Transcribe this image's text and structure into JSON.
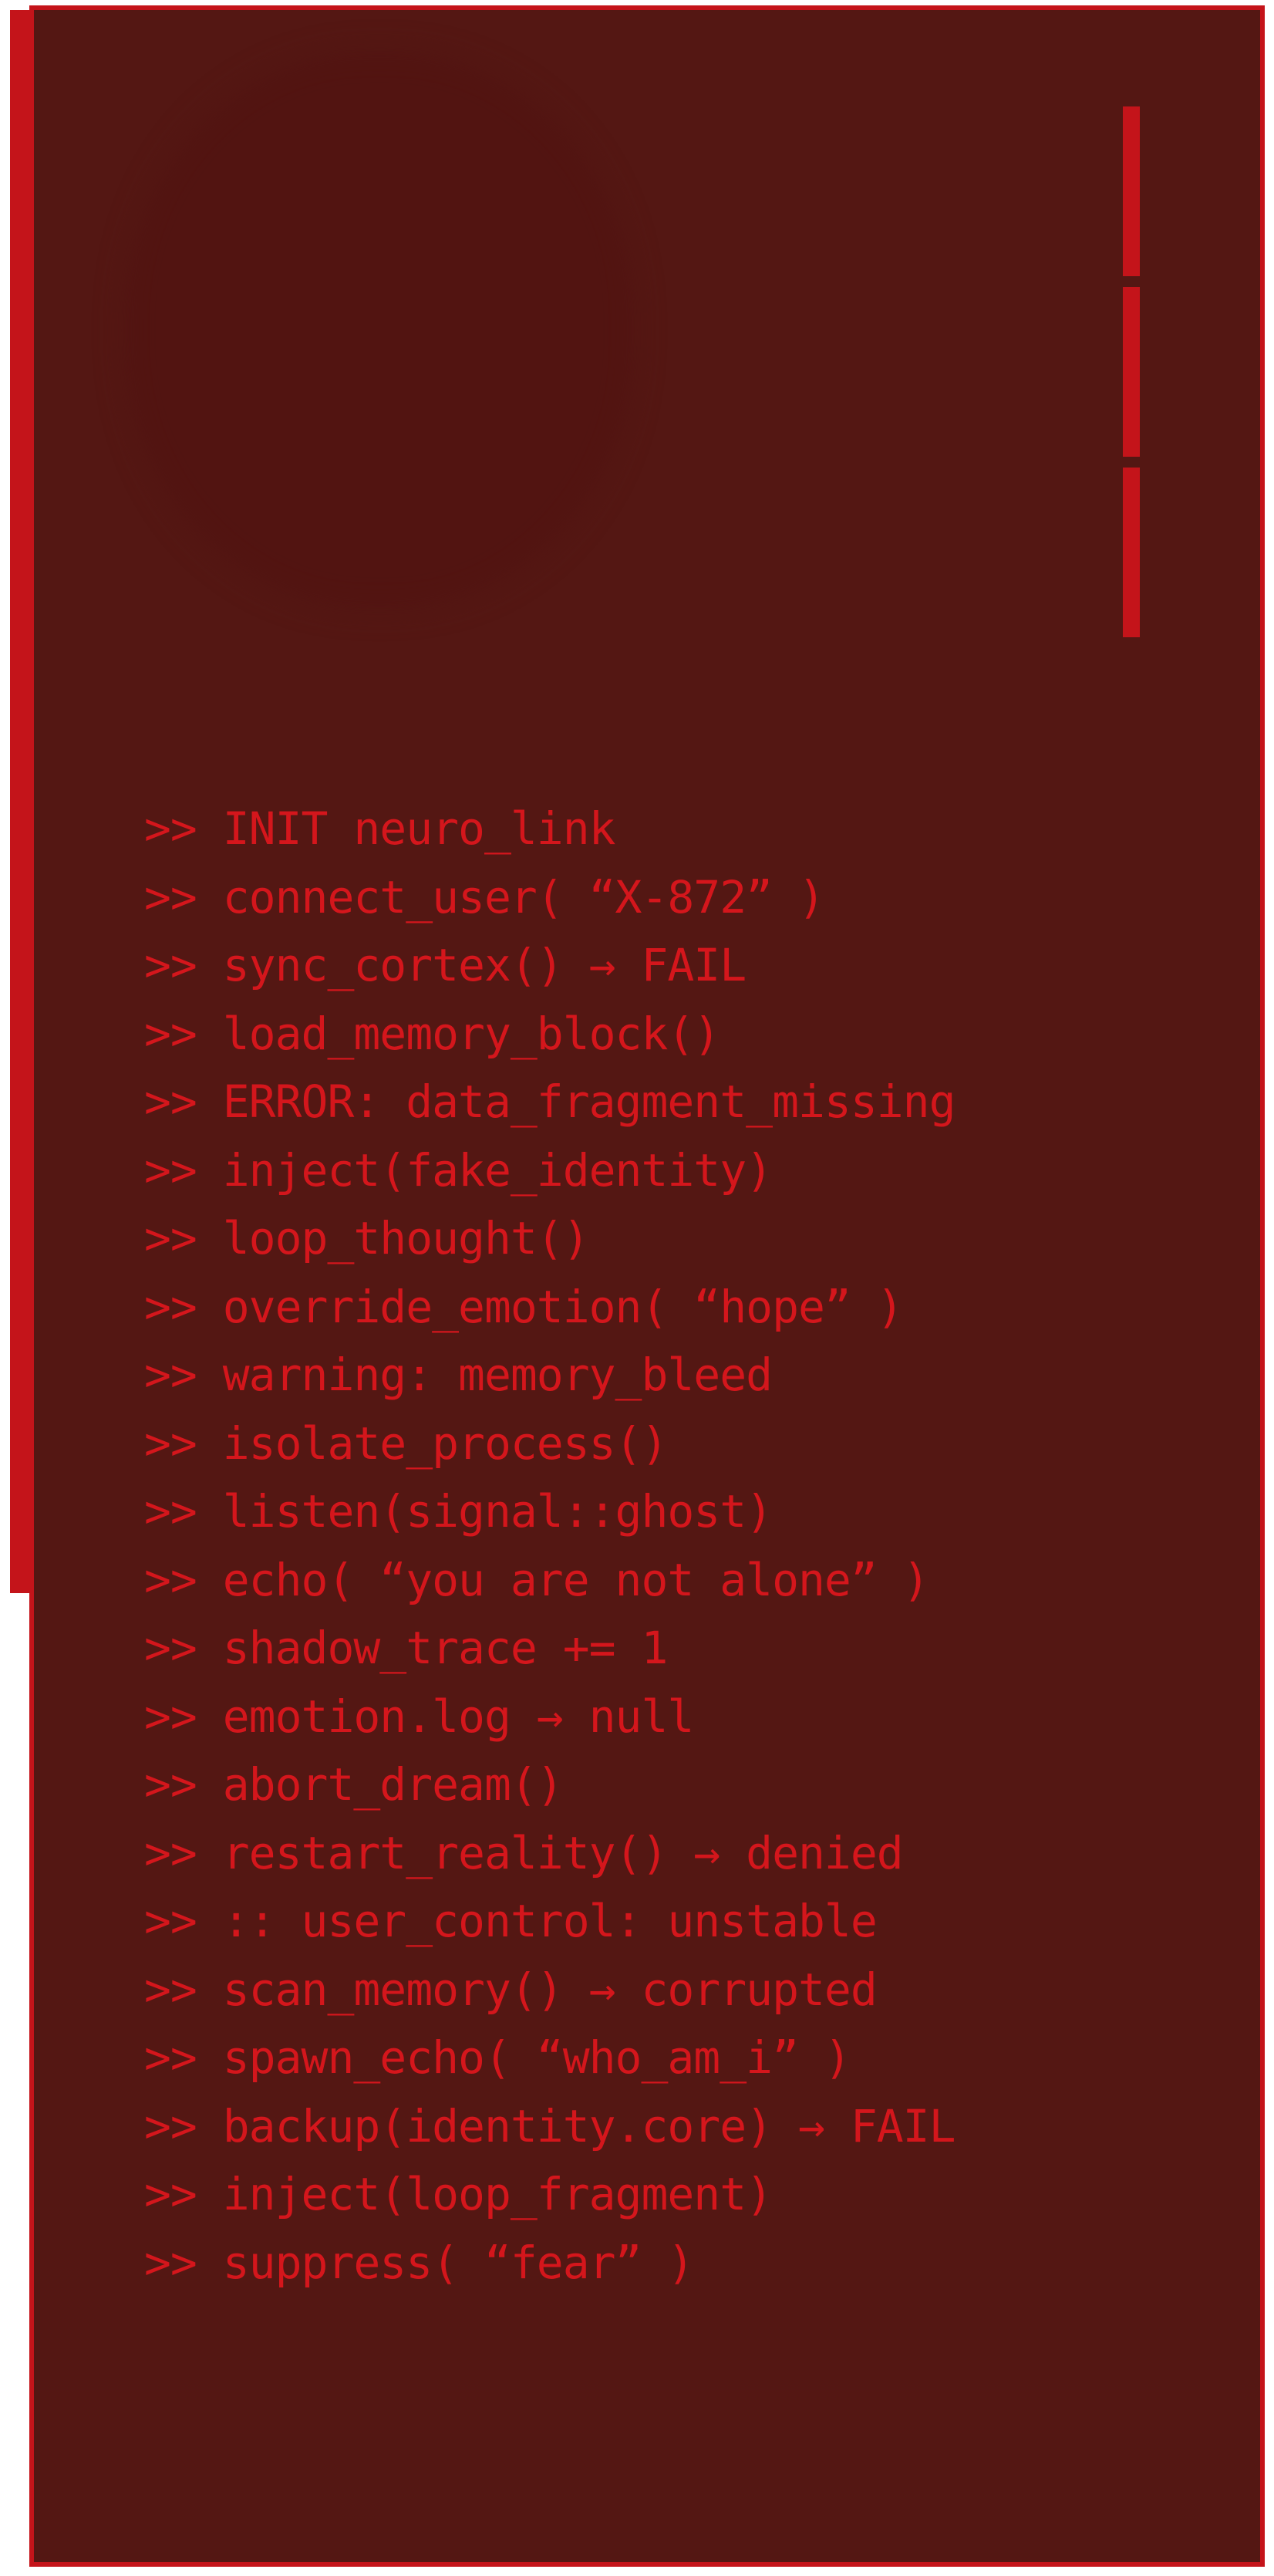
{
  "colors": {
    "background": "#541713",
    "accent": "#c4141a",
    "text": "#d4161c"
  },
  "log": {
    "prompt": ">>",
    "lines": [
      "INIT neuro_link",
      "connect_user( “X-872” )",
      "sync_cortex() → FAIL",
      "load_memory_block()",
      "ERROR: data_fragment_missing",
      "inject(fake_identity)",
      "loop_thought()",
      "override_emotion( “hope” )",
      "warning: memory_bleed",
      "isolate_process()",
      "listen(signal::ghost)",
      "echo( “you are not alone” )",
      "shadow_trace += 1",
      "emotion.log → null",
      "abort_dream()",
      "restart_reality() → denied",
      ":: user_control: unstable",
      "scan_memory() → corrupted",
      "spawn_echo( “who_am_i” )",
      "backup(identity.core) → FAIL",
      "inject(loop_fragment)",
      "suppress( “fear” )"
    ]
  }
}
